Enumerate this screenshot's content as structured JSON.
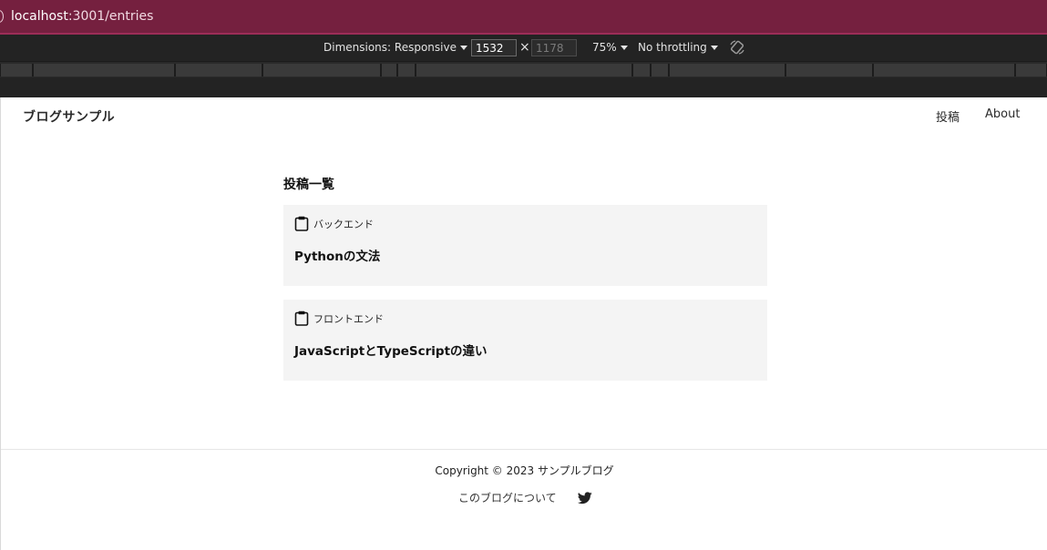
{
  "browser": {
    "url_host": "localhost",
    "url_rest": ":3001/entries"
  },
  "devtools": {
    "dimensions_label": "Dimensions: Responsive",
    "width_value": "1532",
    "times": "×",
    "height_placeholder": "1178",
    "zoom": "75%",
    "throttling": "No throttling",
    "rotate_icon": "rotate-icon"
  },
  "site": {
    "title": "ブログサンプル",
    "nav": [
      {
        "label": "投稿"
      },
      {
        "label": "About"
      }
    ]
  },
  "main": {
    "heading": "投稿一覧",
    "entries": [
      {
        "category": "バックエンド",
        "title": "Pythonの文法",
        "icon": "clipboard-icon"
      },
      {
        "category": "フロントエンド",
        "title": "JavaScriptとTypeScriptの違い",
        "icon": "clipboard-icon"
      }
    ]
  },
  "footer": {
    "copyright": "Copyright © 2023 サンプルブログ",
    "about_link": "このブログについて",
    "social_icon": "twitter-icon"
  }
}
